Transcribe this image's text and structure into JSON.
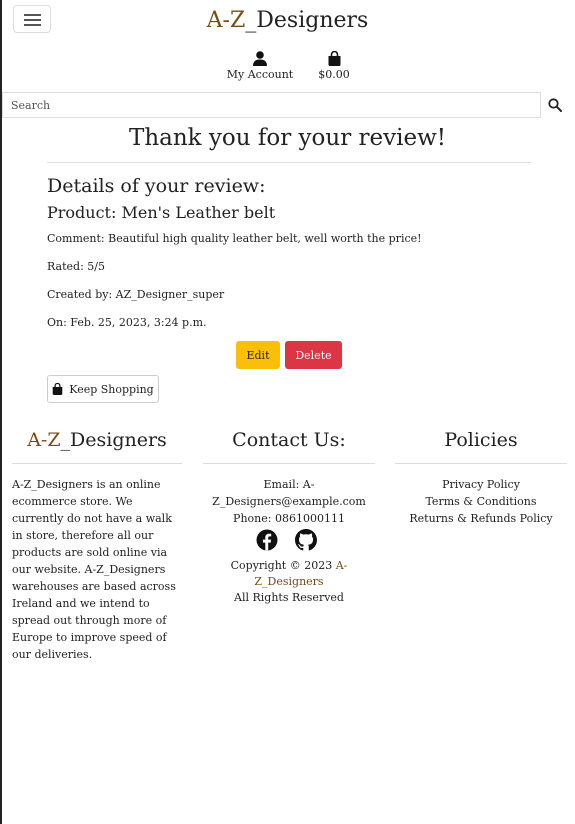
{
  "header": {
    "brand_prefix": "A-Z",
    "brand_suffix": "_Designers",
    "account_label": "My Account",
    "bag_total": "$0.00",
    "search_placeholder": "Search"
  },
  "main": {
    "title": "Thank you for your review!",
    "details_heading": "Details of your review:",
    "product": "Product: Men's Leather belt",
    "comment": "Comment: Beautiful high quality leather belt, well worth the price!",
    "rated": "Rated: 5/5",
    "created_by": "Created by: AZ_Designer_super",
    "on": "On: Feb. 25, 2023, 3:24 p.m.",
    "edit_label": "Edit",
    "delete_label": "Delete",
    "keep_shopping_label": "Keep Shopping"
  },
  "footer": {
    "brand_prefix": "A-Z",
    "brand_suffix": "_Designers",
    "about": "A-Z_Designers is an online ecommerce store. We currently do not have a walk in store, therefore all our products are sold online via our website. A-Z_Designers warehouses are based across Ireland and we intend to spread out through more of Europe to improve speed of our deliveries.",
    "contact_title": "Contact Us:",
    "email": "Email: A-Z_Designers@example.com",
    "phone": "Phone: 0861000111",
    "copyright_prefix": "Copyright © 2023",
    "copyright_brand": "A-Z_Designers",
    "rights": "All Rights Reserved",
    "policies_title": "Policies",
    "policies": [
      "Privacy Policy",
      "Terms & Conditions",
      "Returns & Refunds Policy"
    ]
  },
  "colors": {
    "brand_brown": "#7a4a14",
    "edit_yellow": "#fbbf0a",
    "delete_red": "#dc3545"
  },
  "icons": [
    "menu-icon",
    "user-icon",
    "shopping-bag-icon",
    "search-icon",
    "facebook-icon",
    "github-icon"
  ]
}
